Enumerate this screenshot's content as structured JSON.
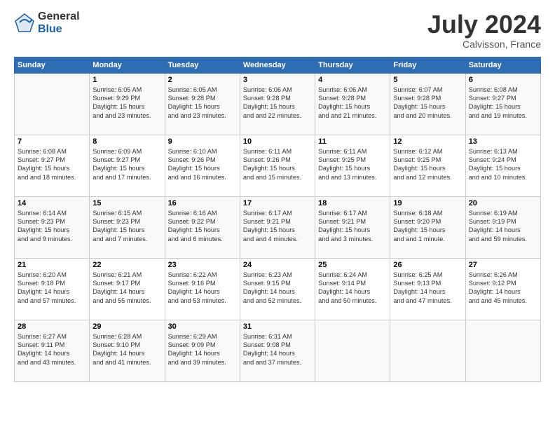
{
  "logo": {
    "general": "General",
    "blue": "Blue"
  },
  "header": {
    "month": "July 2024",
    "location": "Calvisson, France"
  },
  "days_of_week": [
    "Sunday",
    "Monday",
    "Tuesday",
    "Wednesday",
    "Thursday",
    "Friday",
    "Saturday"
  ],
  "weeks": [
    [
      {
        "day": "",
        "sunrise": "",
        "sunset": "",
        "daylight": ""
      },
      {
        "day": "1",
        "sunrise": "Sunrise: 6:05 AM",
        "sunset": "Sunset: 9:29 PM",
        "daylight": "Daylight: 15 hours and 23 minutes."
      },
      {
        "day": "2",
        "sunrise": "Sunrise: 6:05 AM",
        "sunset": "Sunset: 9:28 PM",
        "daylight": "Daylight: 15 hours and 23 minutes."
      },
      {
        "day": "3",
        "sunrise": "Sunrise: 6:06 AM",
        "sunset": "Sunset: 9:28 PM",
        "daylight": "Daylight: 15 hours and 22 minutes."
      },
      {
        "day": "4",
        "sunrise": "Sunrise: 6:06 AM",
        "sunset": "Sunset: 9:28 PM",
        "daylight": "Daylight: 15 hours and 21 minutes."
      },
      {
        "day": "5",
        "sunrise": "Sunrise: 6:07 AM",
        "sunset": "Sunset: 9:28 PM",
        "daylight": "Daylight: 15 hours and 20 minutes."
      },
      {
        "day": "6",
        "sunrise": "Sunrise: 6:08 AM",
        "sunset": "Sunset: 9:27 PM",
        "daylight": "Daylight: 15 hours and 19 minutes."
      }
    ],
    [
      {
        "day": "7",
        "sunrise": "Sunrise: 6:08 AM",
        "sunset": "Sunset: 9:27 PM",
        "daylight": "Daylight: 15 hours and 18 minutes."
      },
      {
        "day": "8",
        "sunrise": "Sunrise: 6:09 AM",
        "sunset": "Sunset: 9:27 PM",
        "daylight": "Daylight: 15 hours and 17 minutes."
      },
      {
        "day": "9",
        "sunrise": "Sunrise: 6:10 AM",
        "sunset": "Sunset: 9:26 PM",
        "daylight": "Daylight: 15 hours and 16 minutes."
      },
      {
        "day": "10",
        "sunrise": "Sunrise: 6:11 AM",
        "sunset": "Sunset: 9:26 PM",
        "daylight": "Daylight: 15 hours and 15 minutes."
      },
      {
        "day": "11",
        "sunrise": "Sunrise: 6:11 AM",
        "sunset": "Sunset: 9:25 PM",
        "daylight": "Daylight: 15 hours and 13 minutes."
      },
      {
        "day": "12",
        "sunrise": "Sunrise: 6:12 AM",
        "sunset": "Sunset: 9:25 PM",
        "daylight": "Daylight: 15 hours and 12 minutes."
      },
      {
        "day": "13",
        "sunrise": "Sunrise: 6:13 AM",
        "sunset": "Sunset: 9:24 PM",
        "daylight": "Daylight: 15 hours and 10 minutes."
      }
    ],
    [
      {
        "day": "14",
        "sunrise": "Sunrise: 6:14 AM",
        "sunset": "Sunset: 9:23 PM",
        "daylight": "Daylight: 15 hours and 9 minutes."
      },
      {
        "day": "15",
        "sunrise": "Sunrise: 6:15 AM",
        "sunset": "Sunset: 9:23 PM",
        "daylight": "Daylight: 15 hours and 7 minutes."
      },
      {
        "day": "16",
        "sunrise": "Sunrise: 6:16 AM",
        "sunset": "Sunset: 9:22 PM",
        "daylight": "Daylight: 15 hours and 6 minutes."
      },
      {
        "day": "17",
        "sunrise": "Sunrise: 6:17 AM",
        "sunset": "Sunset: 9:21 PM",
        "daylight": "Daylight: 15 hours and 4 minutes."
      },
      {
        "day": "18",
        "sunrise": "Sunrise: 6:17 AM",
        "sunset": "Sunset: 9:21 PM",
        "daylight": "Daylight: 15 hours and 3 minutes."
      },
      {
        "day": "19",
        "sunrise": "Sunrise: 6:18 AM",
        "sunset": "Sunset: 9:20 PM",
        "daylight": "Daylight: 15 hours and 1 minute."
      },
      {
        "day": "20",
        "sunrise": "Sunrise: 6:19 AM",
        "sunset": "Sunset: 9:19 PM",
        "daylight": "Daylight: 14 hours and 59 minutes."
      }
    ],
    [
      {
        "day": "21",
        "sunrise": "Sunrise: 6:20 AM",
        "sunset": "Sunset: 9:18 PM",
        "daylight": "Daylight: 14 hours and 57 minutes."
      },
      {
        "day": "22",
        "sunrise": "Sunrise: 6:21 AM",
        "sunset": "Sunset: 9:17 PM",
        "daylight": "Daylight: 14 hours and 55 minutes."
      },
      {
        "day": "23",
        "sunrise": "Sunrise: 6:22 AM",
        "sunset": "Sunset: 9:16 PM",
        "daylight": "Daylight: 14 hours and 53 minutes."
      },
      {
        "day": "24",
        "sunrise": "Sunrise: 6:23 AM",
        "sunset": "Sunset: 9:15 PM",
        "daylight": "Daylight: 14 hours and 52 minutes."
      },
      {
        "day": "25",
        "sunrise": "Sunrise: 6:24 AM",
        "sunset": "Sunset: 9:14 PM",
        "daylight": "Daylight: 14 hours and 50 minutes."
      },
      {
        "day": "26",
        "sunrise": "Sunrise: 6:25 AM",
        "sunset": "Sunset: 9:13 PM",
        "daylight": "Daylight: 14 hours and 47 minutes."
      },
      {
        "day": "27",
        "sunrise": "Sunrise: 6:26 AM",
        "sunset": "Sunset: 9:12 PM",
        "daylight": "Daylight: 14 hours and 45 minutes."
      }
    ],
    [
      {
        "day": "28",
        "sunrise": "Sunrise: 6:27 AM",
        "sunset": "Sunset: 9:11 PM",
        "daylight": "Daylight: 14 hours and 43 minutes."
      },
      {
        "day": "29",
        "sunrise": "Sunrise: 6:28 AM",
        "sunset": "Sunset: 9:10 PM",
        "daylight": "Daylight: 14 hours and 41 minutes."
      },
      {
        "day": "30",
        "sunrise": "Sunrise: 6:29 AM",
        "sunset": "Sunset: 9:09 PM",
        "daylight": "Daylight: 14 hours and 39 minutes."
      },
      {
        "day": "31",
        "sunrise": "Sunrise: 6:31 AM",
        "sunset": "Sunset: 9:08 PM",
        "daylight": "Daylight: 14 hours and 37 minutes."
      },
      {
        "day": "",
        "sunrise": "",
        "sunset": "",
        "daylight": ""
      },
      {
        "day": "",
        "sunrise": "",
        "sunset": "",
        "daylight": ""
      },
      {
        "day": "",
        "sunrise": "",
        "sunset": "",
        "daylight": ""
      }
    ]
  ]
}
